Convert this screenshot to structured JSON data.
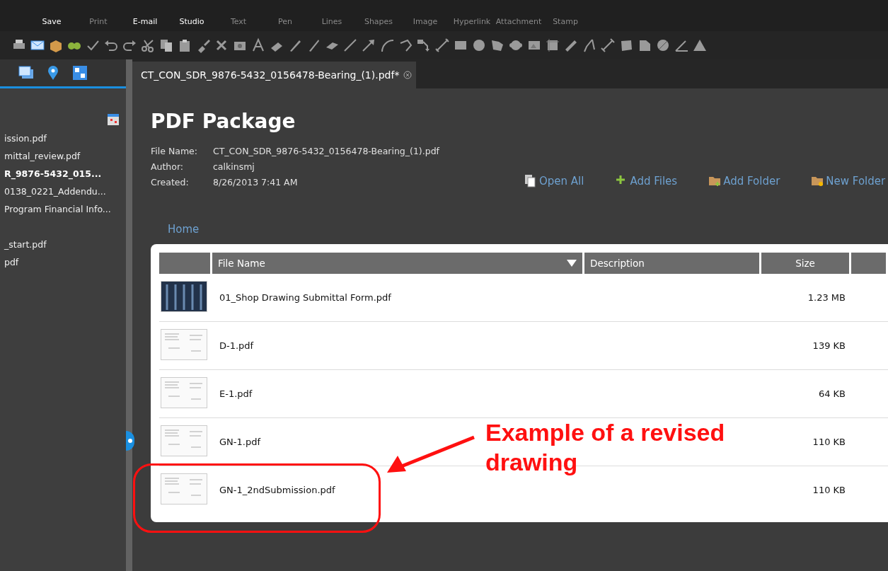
{
  "ribbon": [
    {
      "label": "Save",
      "disabled": false
    },
    {
      "label": "Print",
      "disabled": true
    },
    {
      "label": "E-mail",
      "disabled": false
    },
    {
      "label": "Studio",
      "disabled": false
    },
    {
      "label": "Text",
      "disabled": true
    },
    {
      "label": "Pen",
      "disabled": true
    },
    {
      "label": "Lines",
      "disabled": true
    },
    {
      "label": "Shapes",
      "disabled": true
    },
    {
      "label": "Image",
      "disabled": true
    },
    {
      "label": "Hyperlink",
      "disabled": true
    },
    {
      "label": "Attachment",
      "disabled": true
    },
    {
      "label": "Stamp",
      "disabled": true
    }
  ],
  "sidebar": {
    "groups": [
      [
        {
          "label": "ission.pdf",
          "selected": false
        },
        {
          "label": "mittal_review.pdf",
          "selected": false
        },
        {
          "label": "R_9876-5432_015...",
          "selected": true
        },
        {
          "label": "0138_0221_Addendu...",
          "selected": false
        },
        {
          "label": "Program Financial Info...",
          "selected": false
        }
      ],
      [
        {
          "label": "_start.pdf",
          "selected": false
        },
        {
          "label": "pdf",
          "selected": false
        }
      ]
    ]
  },
  "document_tab": {
    "title": "CT_CON_SDR_9876-5432_0156478-Bearing_(1).pdf*"
  },
  "package": {
    "title": "PDF Package",
    "info": [
      {
        "label": "File Name:",
        "value": "CT_CON_SDR_9876-5432_0156478-Bearing_(1).pdf"
      },
      {
        "label": "Author:",
        "value": "calkinsmj"
      },
      {
        "label": "Created:",
        "value": "8/26/2013 7:41 AM"
      }
    ],
    "actions": [
      {
        "kind": "open",
        "label": "Open All"
      },
      {
        "kind": "add",
        "label": "Add Files"
      },
      {
        "kind": "addfolder",
        "label": "Add Folder"
      },
      {
        "kind": "newfolder",
        "label": "New Folder"
      }
    ],
    "breadcrumb": "Home",
    "table": {
      "columns": [
        "File Name",
        "Description",
        "Size"
      ],
      "rows": [
        {
          "kind": "dark",
          "name": "01_Shop Drawing Submittal Form.pdf",
          "size": "1.23 MB"
        },
        {
          "kind": "plan",
          "name": "D-1.pdf",
          "size": "139 KB"
        },
        {
          "kind": "plan",
          "name": "E-1.pdf",
          "size": "64 KB"
        },
        {
          "kind": "plan",
          "name": "GN-1.pdf",
          "size": "110 KB"
        },
        {
          "kind": "plan",
          "name": "GN-1_2ndSubmission.pdf",
          "size": "110 KB"
        }
      ]
    }
  },
  "annotation": {
    "text": "Example of a revised drawing"
  }
}
